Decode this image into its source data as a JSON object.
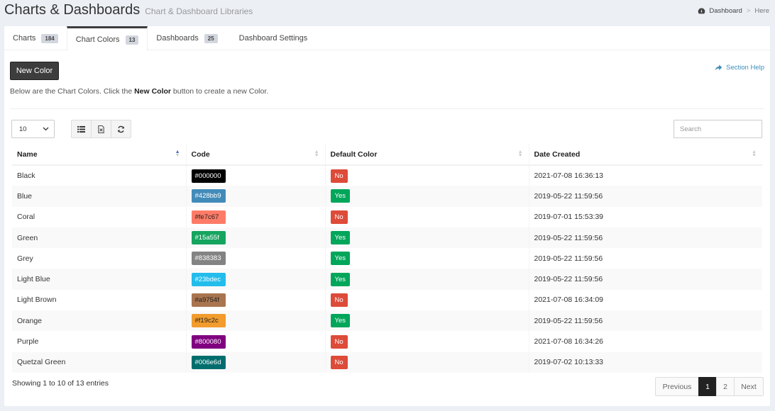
{
  "header": {
    "title": "Charts & Dashboards",
    "subtitle": "Chart & Dashboard Libraries",
    "breadcrumb": {
      "home": "Dashboard",
      "separator": ">",
      "current": "Here",
      "home_icon": "dashboard-icon"
    }
  },
  "tabs": [
    {
      "label": "Charts",
      "badge": "184"
    },
    {
      "label": "Chart Colors",
      "badge": "13",
      "active": true
    },
    {
      "label": "Dashboards",
      "badge": "25"
    },
    {
      "label": "Dashboard Settings"
    }
  ],
  "toolbar": {
    "new_button": "New Color",
    "section_help": "Section Help",
    "intro_before": "Below are the Chart Colors. Click the ",
    "intro_bold": "New Color",
    "intro_after": " button to create a new Color."
  },
  "controls": {
    "page_length": "10",
    "search_placeholder": "Search",
    "buttons": [
      "list-icon",
      "excel-icon",
      "refresh-icon"
    ]
  },
  "table": {
    "headers": [
      "Name",
      "Code",
      "Default Color",
      "Date Created"
    ],
    "rows": [
      {
        "name": "Black",
        "code": "#000000",
        "default": "No",
        "created": "2021-07-08 16:36:13"
      },
      {
        "name": "Blue",
        "code": "#428bb9",
        "default": "Yes",
        "created": "2019-05-22 11:59:56"
      },
      {
        "name": "Coral",
        "code": "#fe7c67",
        "default": "No",
        "created": "2019-07-01 15:53:39"
      },
      {
        "name": "Green",
        "code": "#15a55f",
        "default": "Yes",
        "created": "2019-05-22 11:59:56"
      },
      {
        "name": "Grey",
        "code": "#838383",
        "default": "Yes",
        "created": "2019-05-22 11:59:56"
      },
      {
        "name": "Light Blue",
        "code": "#23bdec",
        "default": "Yes",
        "created": "2019-05-22 11:59:56"
      },
      {
        "name": "Light Brown",
        "code": "#a9754f",
        "default": "No",
        "created": "2021-07-08 16:34:09"
      },
      {
        "name": "Orange",
        "code": "#f19c2c",
        "default": "Yes",
        "created": "2019-05-22 11:59:56"
      },
      {
        "name": "Purple",
        "code": "#800080",
        "default": "No",
        "created": "2021-07-08 16:34:26"
      },
      {
        "name": "Quetzal Green",
        "code": "#006e6d",
        "default": "No",
        "created": "2019-07-02 10:13:33"
      }
    ]
  },
  "footer": {
    "info": "Showing 1 to 10 of 13 entries",
    "previous": "Previous",
    "pages": [
      "1",
      "2"
    ],
    "current_page": "1",
    "next": "Next"
  },
  "colors": {
    "accent_link": "#3c8dbc",
    "yes": "#00a65a",
    "no": "#dd4b39",
    "primary_button": "#3d3d3d"
  }
}
